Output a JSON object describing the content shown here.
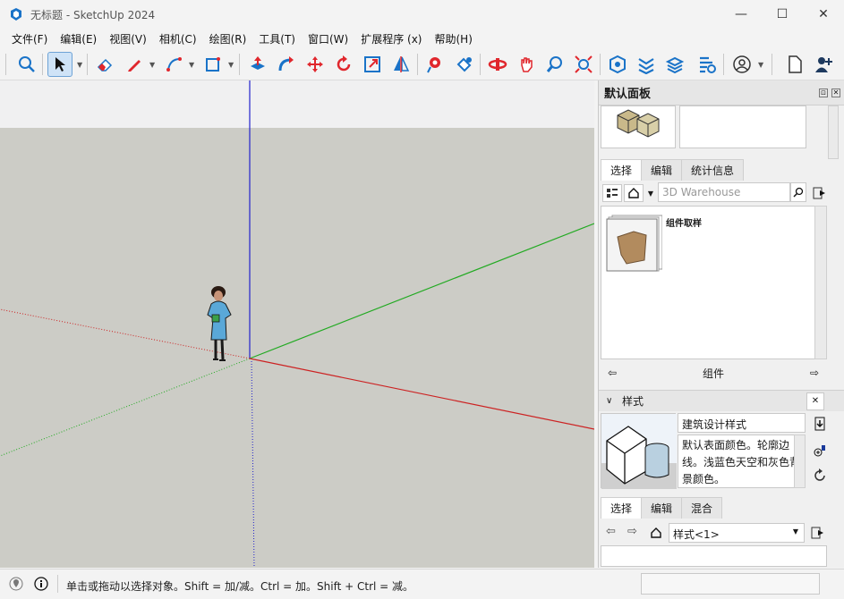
{
  "window": {
    "title": "无标题 - SketchUp 2024",
    "minimize": "—",
    "maximize": "☐",
    "close": "✕"
  },
  "menu": {
    "items": [
      "文件(F)",
      "编辑(E)",
      "视图(V)",
      "相机(C)",
      "绘图(R)",
      "工具(T)",
      "窗口(W)",
      "扩展程序 (x)",
      "帮助(H)"
    ]
  },
  "toolbar": {
    "icons": [
      "zoom-extents-icon",
      "select-icon",
      "eraser-icon",
      "pencil-line-icon",
      "arc-icon",
      "rectangle-icon",
      "push-pull-icon",
      "follow-me-icon",
      "move-icon",
      "rotate-icon",
      "scale-icon",
      "mirror-icon",
      "tape-measure-icon",
      "paint-bucket-icon",
      "orbit-icon",
      "pan-icon",
      "zoom-icon",
      "zoom-window-icon",
      "extension-warehouse-icon",
      "3d-warehouse-icon",
      "layout-icon",
      "trimble-connect-icon",
      "account-icon",
      "new-file-icon",
      "add-user-icon"
    ],
    "accent": "#1a73c8",
    "red": "#e0272d"
  },
  "viewport": {
    "sky_color": "#f0f0f1",
    "ground_color": "#ccccc6",
    "axis_red": "#cc2222",
    "axis_green": "#22aa22",
    "axis_blue": "#2222cc"
  },
  "tray": {
    "title": "默认面板",
    "pin": "⊡",
    "close": "✕",
    "components": {
      "tabs": [
        "选择",
        "编辑",
        "统计信息"
      ],
      "search_placeholder": "3D Warehouse",
      "item_label": "组件取样",
      "footer": "组件"
    },
    "styles": {
      "section_title": "样式",
      "close": "✕",
      "style_name": "建筑设计样式",
      "description": "默认表面颜色。轮廓边线。浅蓝色天空和灰色背景颜色。",
      "tabs": [
        "选择",
        "编辑",
        "混合"
      ],
      "selected": "样式<1>"
    }
  },
  "status": {
    "text": "单击或拖动以选择对象。Shift = 加/减。Ctrl = 加。Shift + Ctrl = 减。"
  }
}
